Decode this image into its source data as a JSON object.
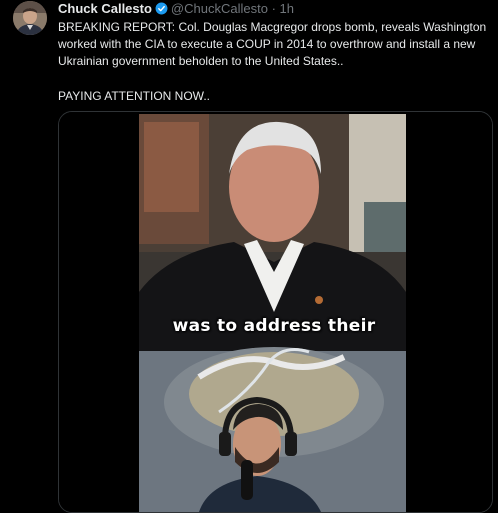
{
  "tweet": {
    "display_name": "Chuck Callesto",
    "handle": "@ChuckCallesto",
    "separator": "·",
    "time": "1h",
    "text_line1": "BREAKING REPORT: Col. Douglas Macgregor drops bomb, reveals Washington worked with the CIA to execute a COUP in 2014 to overthrow and install a new Ukrainian government beholden to the United States..",
    "text_line2": "PAYING ATTENTION NOW.."
  },
  "video": {
    "caption": "was to address their"
  },
  "icons": {
    "verified": "verified-badge-icon"
  },
  "colors": {
    "background": "#000000",
    "verified": "#1d9bf0",
    "secondary_text": "#71767b",
    "border": "#2f3336"
  }
}
